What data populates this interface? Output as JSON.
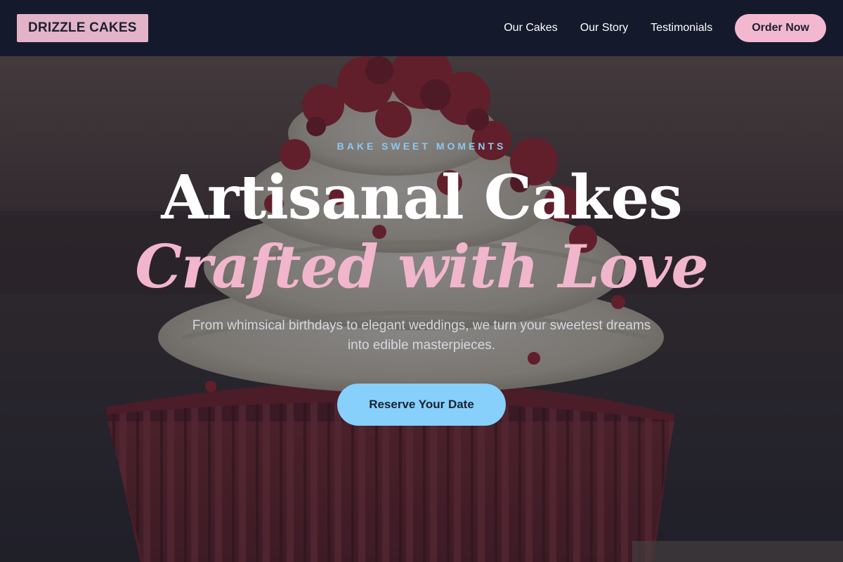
{
  "header": {
    "logo": "DRIZZLE CAKES",
    "nav": [
      "Our Cakes",
      "Our Story",
      "Testimonials"
    ],
    "order_button": "Order Now"
  },
  "hero": {
    "eyebrow": "BAKE SWEET MOMENTS",
    "title_line1": "Artisanal Cakes",
    "title_line2": "Crafted with Love",
    "subtitle": "From whimsical birthdays to elegant weddings, we turn your sweetest dreams into edible masterpieces.",
    "cta": "Reserve Your Date",
    "background_image": "red-velvet-cupcake"
  },
  "colors": {
    "header_bg": "#141a2b",
    "logo_bg": "#e3b3c7",
    "accent_pink": "#f1b6cc",
    "accent_blue": "#86d0fb",
    "eyebrow_blue": "#8cc8ef"
  }
}
